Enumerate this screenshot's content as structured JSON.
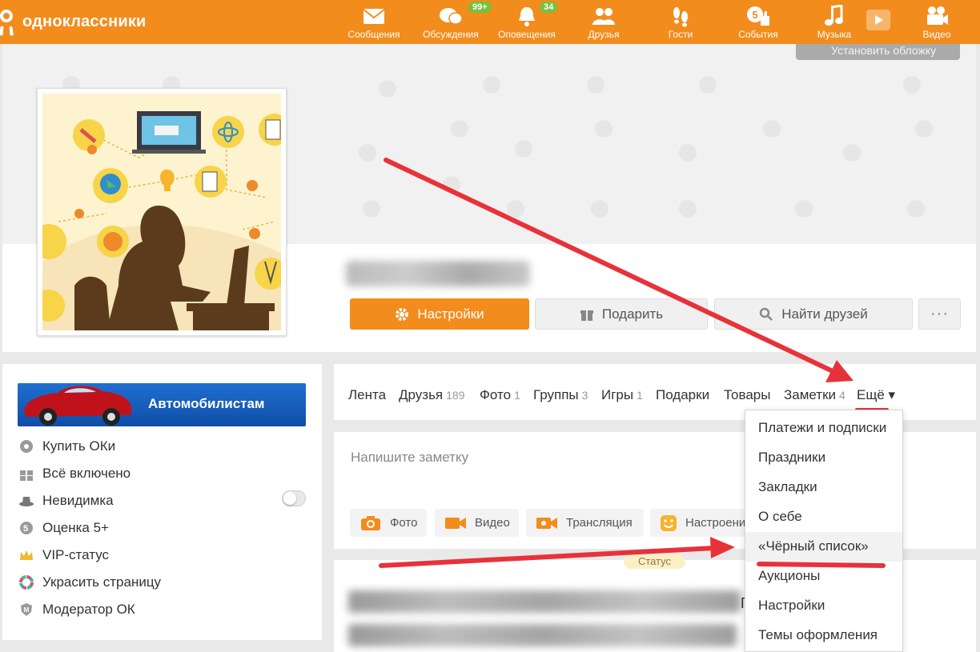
{
  "brand": {
    "name": "одноклассники",
    "accent": "#f28c1c"
  },
  "nav": [
    {
      "label": "Сообщения",
      "icon": "envelope-icon"
    },
    {
      "label": "Обсуждения",
      "icon": "chat-bubbles-icon",
      "badge": "99+"
    },
    {
      "label": "Оповещения",
      "icon": "bell-icon",
      "badge": "34"
    },
    {
      "label": "Друзья",
      "icon": "friends-icon"
    },
    {
      "label": "Гости",
      "icon": "footprints-icon"
    },
    {
      "label": "События",
      "icon": "five-plus-like-icon",
      "badge_glyph": "5"
    },
    {
      "label": "Музыка",
      "icon": "music-note-icon"
    },
    {
      "label": "Видео",
      "icon": "video-camera-icon"
    }
  ],
  "cover": {
    "button": "Установить обложку"
  },
  "profile": {
    "actions": {
      "settings": "Настройки",
      "gift": "Подарить",
      "find": "Найти друзей",
      "more": "···"
    }
  },
  "left": {
    "banner": "Автомобилистам",
    "items": [
      {
        "label": "Купить ОКи",
        "icon": "coin-icon"
      },
      {
        "label": "Всё включено",
        "icon": "gift-box-icon"
      },
      {
        "label": "Невидимка",
        "icon": "hat-icon",
        "toggle": false
      },
      {
        "label": "Оценка 5+",
        "icon": "five-plus-icon"
      },
      {
        "label": "VIP-статус",
        "icon": "crown-icon"
      },
      {
        "label": "Украсить страницу",
        "icon": "color-ring-icon"
      },
      {
        "label": "Модератор ОК",
        "icon": "moderator-shield-icon"
      }
    ]
  },
  "tabs": [
    {
      "label": "Лента",
      "count": ""
    },
    {
      "label": "Друзья",
      "count": "189"
    },
    {
      "label": "Фото",
      "count": "1"
    },
    {
      "label": "Группы",
      "count": "3"
    },
    {
      "label": "Игры",
      "count": "1"
    },
    {
      "label": "Подарки",
      "count": ""
    },
    {
      "label": "Товары",
      "count": ""
    },
    {
      "label": "Заметки",
      "count": "4"
    },
    {
      "label": "Ещё ▾",
      "count": ""
    }
  ],
  "note": {
    "placeholder": "Напишите заметку",
    "chips": [
      {
        "label": "Фото",
        "icon": "camera-icon"
      },
      {
        "label": "Видео",
        "icon": "video-icon"
      },
      {
        "label": "Трансляция",
        "icon": "broadcast-icon"
      },
      {
        "label": "Настроени",
        "icon": "smiley-icon"
      }
    ]
  },
  "feed": {
    "status_label": "Статус",
    "stray_char": "Г"
  },
  "dropdown": {
    "items": [
      "Платежи и подписки",
      "Праздники",
      "Закладки",
      "О себе",
      "«Чёрный список»",
      "Аукционы",
      "Настройки",
      "Темы оформления"
    ],
    "highlighted_index": 4
  },
  "colors": {
    "annotation_arrow": "#e8323a",
    "badge": "#75c13b",
    "banner": "#1f6fd0"
  }
}
